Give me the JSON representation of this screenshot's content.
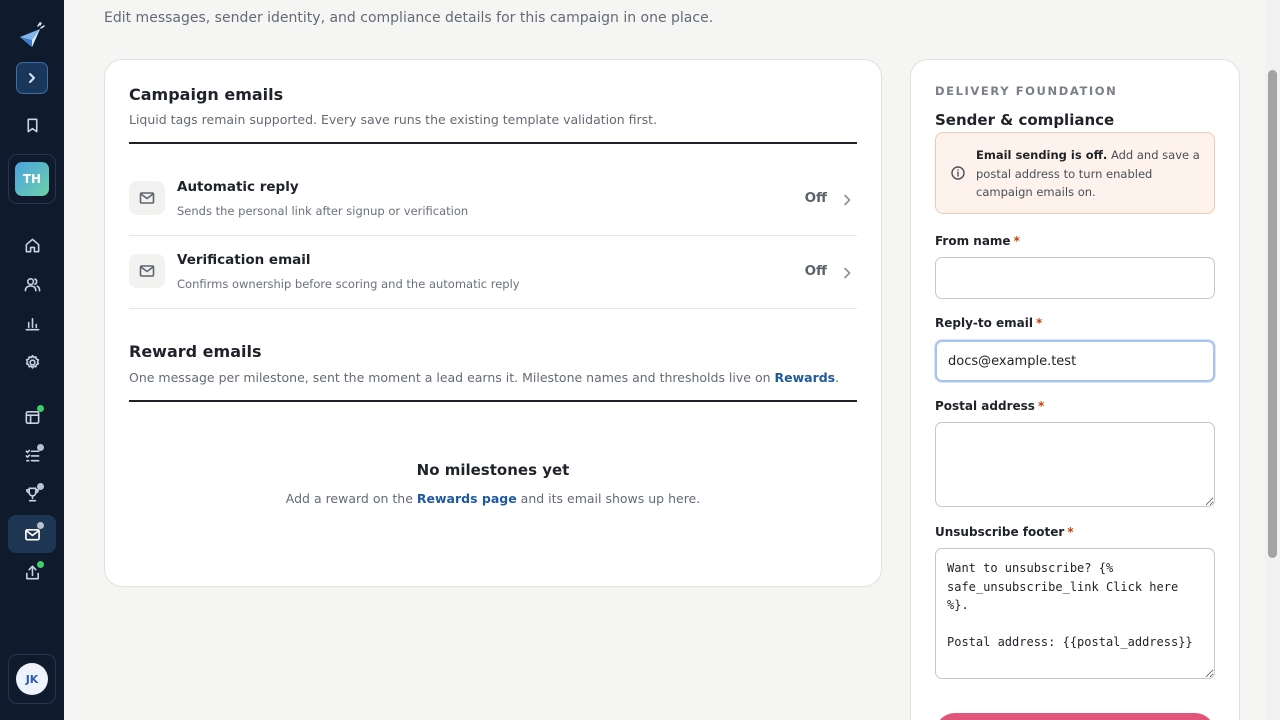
{
  "page": {
    "intro": "Edit messages, sender identity, and compliance details for this campaign in one place."
  },
  "sidebar": {
    "workspace_initials": "TH",
    "user_initials": "JK",
    "items": [
      {
        "icon": "rocket-logo-icon"
      },
      {
        "icon": "chevron-right-icon"
      },
      {
        "icon": "bookmark-icon"
      },
      {
        "icon": "home-icon"
      },
      {
        "icon": "users-icon"
      },
      {
        "icon": "bar-chart-icon"
      },
      {
        "icon": "gear-icon"
      },
      {
        "icon": "layout-icon",
        "badge": "green"
      },
      {
        "icon": "checklist-icon",
        "badge": "gray"
      },
      {
        "icon": "trophy-icon",
        "badge": "gray"
      },
      {
        "icon": "mail-icon",
        "badge": "gray",
        "active": true
      },
      {
        "icon": "upload-icon",
        "badge": "green"
      }
    ],
    "colors": {
      "background": "#0f1b2d",
      "badge_green": "#3ecf6a",
      "badge_gray": "#b9c1cc"
    }
  },
  "campaign": {
    "title": "Campaign emails",
    "subtitle": "Liquid tags remain supported. Every save runs the existing template validation first.",
    "rows": [
      {
        "title": "Automatic reply",
        "desc": "Sends the personal link after signup or verification",
        "status": "Off"
      },
      {
        "title": "Verification email",
        "desc": "Confirms ownership before scoring and the automatic reply",
        "status": "Off"
      }
    ]
  },
  "rewards": {
    "title": "Reward emails",
    "subtitle_before": "One message per milestone, sent the moment a lead earns it. Milestone names and thresholds live on ",
    "subtitle_link": "Rewards",
    "subtitle_after": ".",
    "empty_title": "No milestones yet",
    "empty_before": "Add a reward on the ",
    "empty_link": "Rewards page",
    "empty_after": " and its email shows up here."
  },
  "side": {
    "eyebrow": "DELIVERY FOUNDATION",
    "title": "Sender & compliance",
    "alert_bold": "Email sending is off.",
    "alert_rest": " Add and save a postal address to turn enabled campaign emails on.",
    "fields": {
      "from_name": {
        "label": "From name",
        "value": ""
      },
      "reply_to": {
        "label": "Reply-to email",
        "value": "docs@example.test"
      },
      "postal": {
        "label": "Postal address",
        "value": ""
      },
      "footer": {
        "label": "Unsubscribe footer",
        "value": "Want to unsubscribe? {% safe_unsubscribe_link Click here %}.\n\nPostal address: {{postal_address}}"
      }
    },
    "required_mark": "*",
    "colors": {
      "alert_bg": "#fdf3ec",
      "alert_border": "#f0c9b4",
      "required": "#c2410c",
      "save_button": "#e2557b",
      "link": "#1e5a9e"
    }
  }
}
